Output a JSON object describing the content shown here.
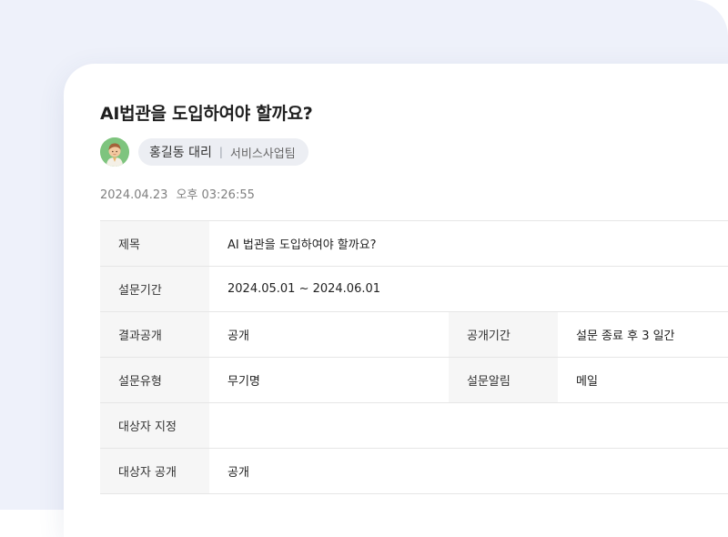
{
  "post": {
    "title": "AI법관을 도입하여야 할까요?",
    "author": {
      "name": "홍길동 대리",
      "separator": "|",
      "team": "서비스사업팀",
      "avatar_icon": "user-avatar-icon"
    },
    "date": "2024.04.23",
    "time": "오후 03:26:55"
  },
  "details": {
    "subject_label": "제목",
    "subject_value": "AI 법관을 도입하여야 할까요?",
    "period_label": "설문기간",
    "period_value": "2024.05.01 ~ 2024.06.01",
    "result_label": "결과공개",
    "result_value": "공개",
    "disclosure_period_label": "공개기간",
    "disclosure_period_value": "설문 종료 후  3 일간",
    "type_label": "설문유형",
    "type_value": "무기명",
    "notify_label": "설문알림",
    "notify_value": "메일",
    "target_label": "대상자 지정",
    "target_value": "",
    "target_public_label": "대상자 공개",
    "target_public_value": "공개"
  },
  "colors": {
    "backdrop": "#eef1fa",
    "card": "#ffffff",
    "label_bg": "#f6f6f6",
    "chip_bg": "#eceef3",
    "avatar_bg": "#7ec47e"
  }
}
